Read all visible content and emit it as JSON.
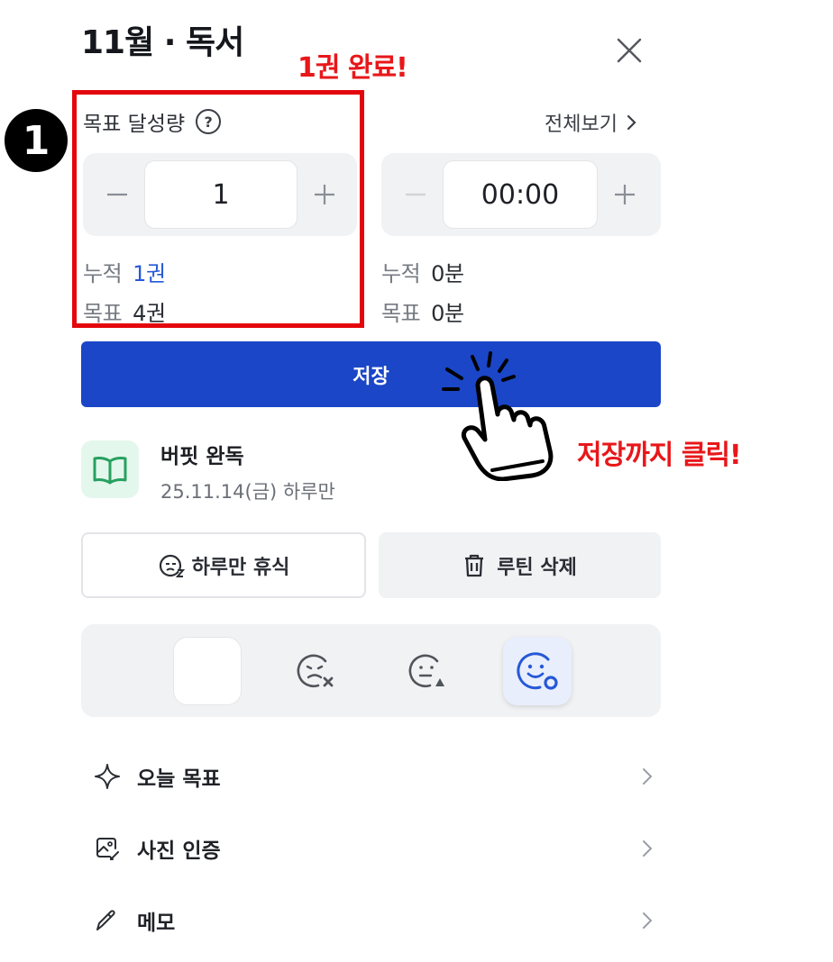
{
  "header": {
    "title": "11월 · 독서"
  },
  "annotations": {
    "top_note": "1권 완료!",
    "side_note": "저장까지 클릭!",
    "step_number": "1"
  },
  "goal": {
    "label": "목표 달성량",
    "help_icon": "?",
    "see_all": "전체보기"
  },
  "count_stepper": {
    "value": "1"
  },
  "time_stepper": {
    "value": "00:00"
  },
  "count_stats": {
    "acc_label": "누적",
    "acc_value": "1권",
    "goal_label": "목표",
    "goal_value": "4권"
  },
  "time_stats": {
    "acc_label": "누적",
    "acc_value": "0분",
    "goal_label": "목표",
    "goal_value": "0분"
  },
  "save_button": {
    "label": "저장"
  },
  "routine": {
    "name": "버핏 완독",
    "date": "25.11.14(금) 하루만",
    "icon": "book-icon"
  },
  "actions": {
    "rest_label": "하루만 휴식",
    "delete_label": "루틴 삭제"
  },
  "status_options": [
    "blank",
    "sad-x-face",
    "neutral-warning-face",
    "happy-circle-face"
  ],
  "status_selected": "happy-circle-face",
  "menu": [
    {
      "label": "오늘 목표",
      "icon": "sparkle-icon"
    },
    {
      "label": "사진 인증",
      "icon": "photo-icon"
    },
    {
      "label": "메모",
      "icon": "pencil-icon"
    }
  ],
  "colors": {
    "primary": "#1a46c7",
    "accent_blue": "#2658d6",
    "annotation_red": "#e8171a",
    "panel_bg": "#f1f2f4",
    "book_bg": "#e4f7ec"
  }
}
